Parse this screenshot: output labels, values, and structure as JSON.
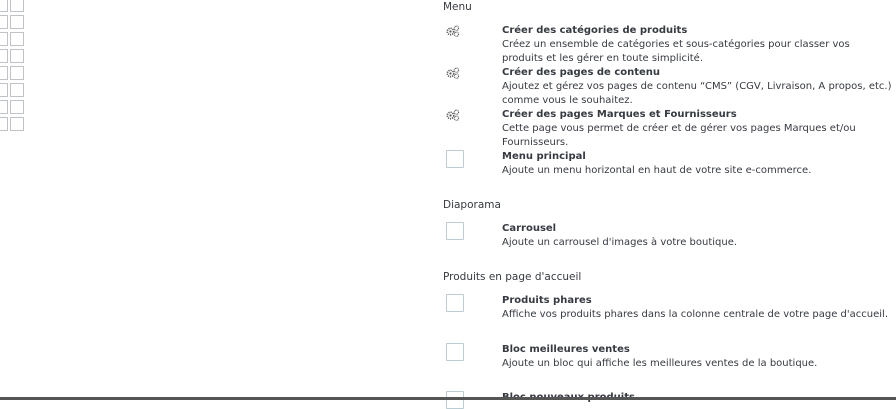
{
  "sections": {
    "menu": {
      "title": "Menu",
      "items": [
        {
          "title": "Créer des catégories de produits",
          "desc": "Créez un ensemble de catégories et sous-catégories pour classer vos produits et les gérer en toute simplicité.",
          "icon": "gears-icon"
        },
        {
          "title": "Créer des pages de contenu",
          "desc": "Ajoutez et gérez vos pages de contenu “CMS” (CGV, Livraison, A propos, etc.) comme vous le souhaitez.",
          "icon": "gears-icon"
        },
        {
          "title": "Créer des pages Marques et Fournisseurs",
          "desc": "Cette page vous permet de créer et de gérer vos pages Marques et/ou Fournisseurs.",
          "icon": "gears-icon"
        },
        {
          "title": "Menu principal",
          "desc": "Ajoute un menu horizontal en haut de votre site e-commerce.",
          "checked": false
        }
      ]
    },
    "diaporama": {
      "title": "Diaporama",
      "items": [
        {
          "title": "Carrousel",
          "desc": "Ajoute un carrousel d'images à votre boutique.",
          "checked": false
        }
      ]
    },
    "produits": {
      "title": "Produits en page d'accueil",
      "items": [
        {
          "title": "Produits phares",
          "desc": "Affiche vos produits phares dans la colonne centrale de votre page d'accueil.",
          "checked": false
        },
        {
          "title": "Bloc meilleures ventes",
          "desc": "Ajoute un bloc qui affiche les meilleures ventes de la boutique.",
          "checked": false
        },
        {
          "title": "Bloc nouveaux produits",
          "checked": false
        }
      ]
    }
  },
  "colors": {
    "text": "#363a41",
    "checkbox_border": "#bbcdd2",
    "icon": "#555555"
  }
}
